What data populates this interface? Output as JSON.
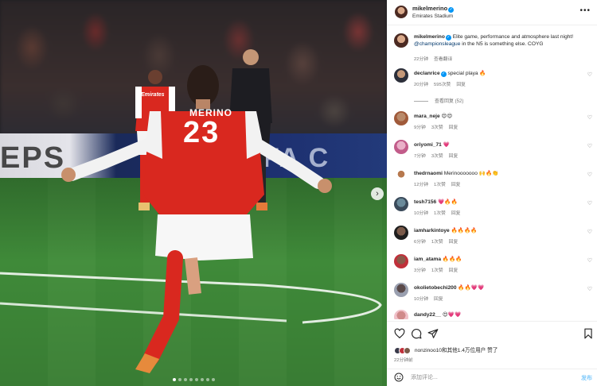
{
  "photo": {
    "board_left_text": "EPS",
    "board_right_text": "FA C",
    "shirt_name": "MERINO",
    "shirt_number": "23",
    "bg_shirt_text": "Emirates",
    "carousel_total": 8,
    "carousel_active": 1
  },
  "header": {
    "username": "mikelmerino",
    "location": "Emirates Stadium"
  },
  "caption": {
    "username": "mikelmerino",
    "text_before": " Elite game, performance and atmosphere last night! ",
    "mention": "@championsleague",
    "text_after": " in the N5 is something else. COYG",
    "time": "22分钟",
    "translate": "查看翻译"
  },
  "comments": [
    {
      "username": "declanrice",
      "verified": true,
      "text": " special playa 🔥",
      "time": "20分钟",
      "likes": "595次赞",
      "reply": "回复",
      "view_replies": "查看回复 (52)"
    },
    {
      "username": "mara_neje",
      "verified": false,
      "text": " 😍😍",
      "time": "9分钟",
      "likes": "3次赞",
      "reply": "回复"
    },
    {
      "username": "oriyomi_71",
      "verified": false,
      "text": " 💗",
      "time": "7分钟",
      "likes": "3次赞",
      "reply": "回复"
    },
    {
      "username": "thedrnaomi",
      "verified": false,
      "text": " Merinooooooo 🙌🔥👏",
      "time": "12分钟",
      "likes": "1次赞",
      "reply": "回复"
    },
    {
      "username": "tesh7156",
      "verified": false,
      "text": " 💗🔥🔥",
      "time": "10分钟",
      "likes": "1次赞",
      "reply": "回复"
    },
    {
      "username": "iamharkintoye",
      "verified": false,
      "text": " 🔥🔥🔥🔥",
      "time": "6分钟",
      "likes": "1次赞",
      "reply": "回复"
    },
    {
      "username": "iam_atama",
      "verified": false,
      "text": " 🔥🔥🔥",
      "time": "3分钟",
      "likes": "1次赞",
      "reply": "回复"
    },
    {
      "username": "okolietobechi200",
      "verified": false,
      "text": " 🔥🔥💗💗",
      "time": "10分钟",
      "likes": "",
      "reply": "回复"
    },
    {
      "username": "dandy22__",
      "verified": false,
      "text": " 😍💗💗",
      "time": "",
      "likes": "",
      "reply": ""
    }
  ],
  "likes": {
    "text": "nonzinoo10和其他1.4万位用户 赞了",
    "time": "22分钟前"
  },
  "input": {
    "placeholder": "添加评论...",
    "post_label": "发布"
  },
  "colors": {
    "arsenal_red": "#d9281f",
    "link_blue": "#00376b",
    "verified_blue": "#0095f6",
    "pitch_green": "#3f8a39"
  }
}
